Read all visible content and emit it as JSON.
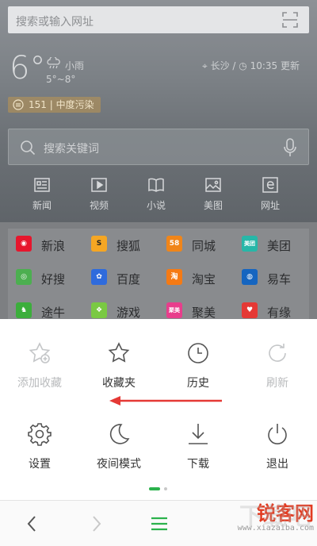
{
  "url_bar": {
    "placeholder": "搜索或输入网址",
    "scan_icon": "scan-icon"
  },
  "weather": {
    "temperature": "6°",
    "condition": "小雨",
    "range": "5°~8°",
    "location": "长沙",
    "updated": "10:35 更新",
    "aqi": "151 | 中度污染"
  },
  "search": {
    "placeholder": "搜索关键词",
    "mic_icon": "mic-icon"
  },
  "quick_nav": [
    {
      "label": "新闻",
      "icon": "news-icon"
    },
    {
      "label": "视频",
      "icon": "video-icon"
    },
    {
      "label": "小说",
      "icon": "book-icon"
    },
    {
      "label": "美图",
      "icon": "image-icon"
    },
    {
      "label": "网址",
      "icon": "url-icon"
    }
  ],
  "sites": [
    {
      "name": "新浪",
      "color": "#e6162d",
      "badge": ""
    },
    {
      "name": "搜狐",
      "color": "#f5a623",
      "badge": "S"
    },
    {
      "name": "同城",
      "color": "#f08519",
      "badge": "58"
    },
    {
      "name": "美团",
      "color": "#27b7a8",
      "badge": "美团"
    },
    {
      "name": "好搜",
      "color": "#4caf50",
      "badge": ""
    },
    {
      "name": "百度",
      "color": "#2f6bdc",
      "badge": ""
    },
    {
      "name": "淘宝",
      "color": "#f57a14",
      "badge": "淘"
    },
    {
      "name": "易车",
      "color": "#1565c0",
      "badge": ""
    },
    {
      "name": "途牛",
      "color": "#3cae3c",
      "badge": ""
    },
    {
      "name": "游戏",
      "color": "#7ac943",
      "badge": ""
    },
    {
      "name": "聚美",
      "color": "#e83e8c",
      "badge": "聚美"
    },
    {
      "name": "有缘",
      "color": "#e53935",
      "badge": ""
    }
  ],
  "menu": {
    "row1": [
      {
        "label": "添加收藏",
        "icon": "star-add-icon",
        "enabled": false
      },
      {
        "label": "收藏夹",
        "icon": "star-icon",
        "enabled": true
      },
      {
        "label": "历史",
        "icon": "clock-icon",
        "enabled": true
      },
      {
        "label": "刷新",
        "icon": "refresh-icon",
        "enabled": false
      }
    ],
    "row2": [
      {
        "label": "设置",
        "icon": "gear-icon",
        "enabled": true
      },
      {
        "label": "夜间模式",
        "icon": "moon-icon",
        "enabled": true
      },
      {
        "label": "下载",
        "icon": "download-icon",
        "enabled": true
      },
      {
        "label": "退出",
        "icon": "power-icon",
        "enabled": true
      }
    ],
    "annotation_color": "#e53935",
    "active_page_color": "#2bb24c"
  },
  "toolbar": {
    "back_icon": "chevron-left-icon",
    "forward_icon": "chevron-right-icon",
    "menu_icon": "hamburger-menu-icon",
    "menu_color": "#2bb24c"
  },
  "watermark": {
    "big": "锐客网",
    "sub": "www.xiazaiba.com"
  }
}
